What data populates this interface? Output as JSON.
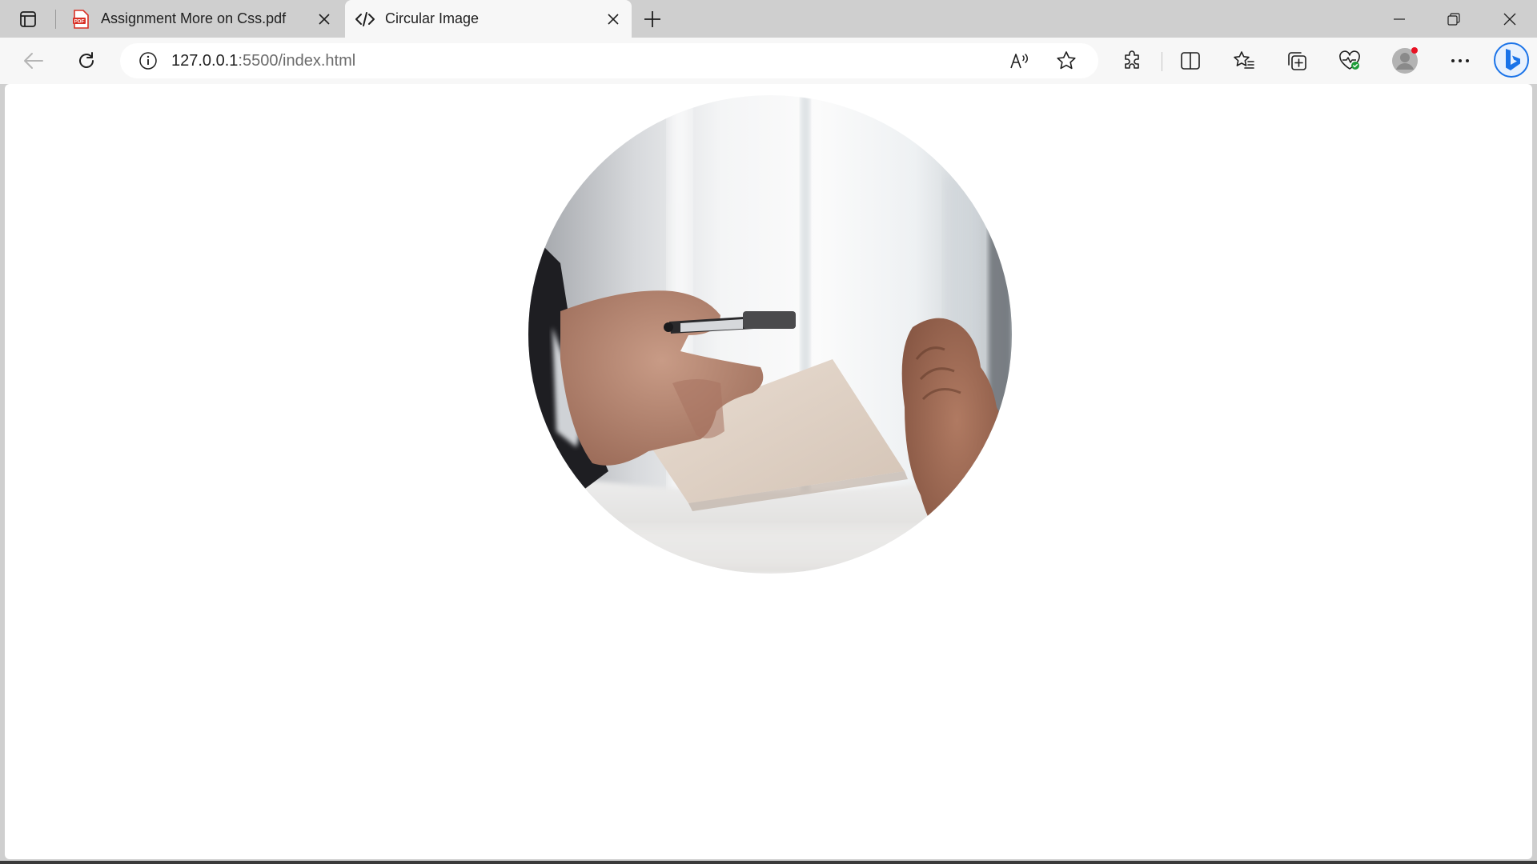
{
  "tabs": [
    {
      "title": "Assignment More on Css.pdf",
      "icon": "pdf-icon",
      "active": false
    },
    {
      "title": "Circular Image",
      "icon": "code-icon",
      "active": true
    }
  ],
  "address": {
    "host": "127.0.0.1",
    "path": ":5500/index.html"
  },
  "toolbar_icons": [
    "back-arrow-icon",
    "refresh-icon",
    "read-aloud-icon",
    "favorite-star-icon",
    "extensions-icon",
    "split-screen-icon",
    "favorites-list-icon",
    "collections-icon",
    "browser-essentials-icon",
    "profile-avatar-icon",
    "more-options-icon",
    "bing-copilot-icon"
  ],
  "window_controls": [
    "minimize-icon",
    "restore-icon",
    "close-window-icon"
  ],
  "content": {
    "image": "circular-photo",
    "image_subject": "hand-offering-pen-and-paper"
  },
  "colors": {
    "tab_strip": "#cfcfcf",
    "toolbar": "#f7f7f7",
    "page": "#ffffff",
    "pdf_red": "#d93025",
    "bing_blue": "#1a73e8"
  }
}
